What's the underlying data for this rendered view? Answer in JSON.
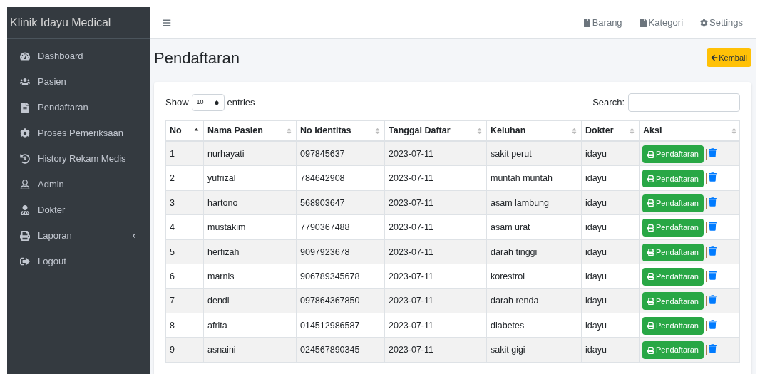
{
  "brand": "Klinik Idayu Medical",
  "sidebar": {
    "items": [
      {
        "label": "Dashboard",
        "submenu": false
      },
      {
        "label": "Pasien",
        "submenu": false
      },
      {
        "label": "Pendaftaran",
        "submenu": false
      },
      {
        "label": "Proses Pemeriksaan",
        "submenu": false
      },
      {
        "label": "History Rekam Medis",
        "submenu": false
      },
      {
        "label": "Admin",
        "submenu": false
      },
      {
        "label": "Dokter",
        "submenu": false
      },
      {
        "label": "Laporan",
        "submenu": true
      },
      {
        "label": "Logout",
        "submenu": false
      }
    ]
  },
  "topbar": {
    "links": [
      "Barang",
      "Kategori",
      "Settings"
    ]
  },
  "page": {
    "title": "Pendaftaran",
    "back_button": "Kembali"
  },
  "table_controls": {
    "show": "Show",
    "page_size": "10",
    "entries": "entries",
    "search_label": "Search:"
  },
  "table": {
    "columns": [
      {
        "label": "No",
        "sorted": true
      },
      {
        "label": "Nama Pasien",
        "sorted": false
      },
      {
        "label": "No Identitas",
        "sorted": false
      },
      {
        "label": "Tanggal Daftar",
        "sorted": false
      },
      {
        "label": "Keluhan",
        "sorted": false
      },
      {
        "label": "Dokter",
        "sorted": false
      },
      {
        "label": "Aksi",
        "sorted": false
      }
    ],
    "rows": [
      {
        "cells": [
          "1",
          "nurhayati",
          "097845637",
          "2023-07-11",
          "sakit perut",
          "idayu"
        ],
        "action": "Pendaftaran"
      },
      {
        "cells": [
          "2",
          "yufrizal",
          "784642908",
          "2023-07-11",
          "muntah muntah",
          "idayu"
        ],
        "action": "Pendaftaran"
      },
      {
        "cells": [
          "3",
          "hartono",
          "568903647",
          "2023-07-11",
          "asam lambung",
          "idayu"
        ],
        "action": "Pendaftaran"
      },
      {
        "cells": [
          "4",
          "mustakim",
          "7790367488",
          "2023-07-11",
          "asam urat",
          "idayu"
        ],
        "action": "Pendaftaran"
      },
      {
        "cells": [
          "5",
          "herfizah",
          "9097923678",
          "2023-07-11",
          "darah tinggi",
          "idayu"
        ],
        "action": "Pendaftaran"
      },
      {
        "cells": [
          "6",
          "marnis",
          "906789345678",
          "2023-07-11",
          "korestrol",
          "idayu"
        ],
        "action": "Pendaftaran"
      },
      {
        "cells": [
          "7",
          "dendi",
          "097864367850",
          "2023-07-11",
          "darah renda",
          "idayu"
        ],
        "action": "Pendaftaran"
      },
      {
        "cells": [
          "8",
          "afrita",
          "014512986587",
          "2023-07-11",
          "diabetes",
          "idayu"
        ],
        "action": "Pendaftaran"
      },
      {
        "cells": [
          "9",
          "asnaini",
          "024567890345",
          "2023-07-11",
          "sakit gigi",
          "idayu"
        ],
        "action": "Pendaftaran"
      }
    ]
  }
}
